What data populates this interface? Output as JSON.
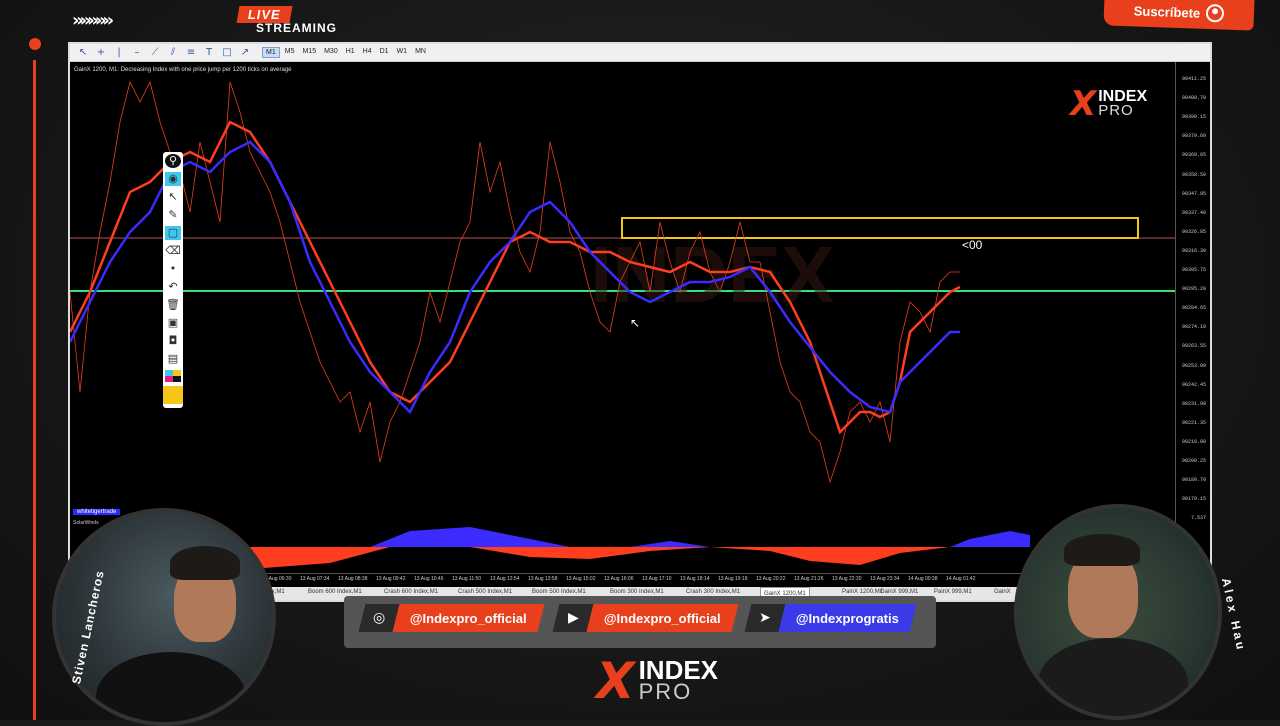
{
  "header": {
    "live_label": "LIVE",
    "streaming_label": "STREAMING",
    "subscribe_label": "Suscríbete",
    "chevrons": "»»»»»"
  },
  "toolbar": {
    "tools": [
      "cursor-icon",
      "crosshair-icon",
      "vline-icon",
      "hline-icon",
      "trendline-icon",
      "channel-icon",
      "fibo-icon",
      "text-icon",
      "shapes-icon",
      "arrows-icon"
    ],
    "timeframes": [
      "M1",
      "M5",
      "M15",
      "M30",
      "H1",
      "H4",
      "D1",
      "W1",
      "MN"
    ],
    "active_timeframe": "M1"
  },
  "chart": {
    "title": "GainX 1200, M1: Decreasing Index with one price jump per 1200 ticks on average",
    "annotation": "<00",
    "price_labels": [
      "90411.25",
      "90400.70",
      "90390.15",
      "90379.60",
      "90369.05",
      "90358.50",
      "90347.95",
      "90337.40",
      "90326.85",
      "90316.30",
      "90305.75",
      "90295.20",
      "90284.65",
      "90274.10",
      "90263.55",
      "90253.00",
      "90242.45",
      "90231.90",
      "90221.35",
      "90210.80",
      "90200.25",
      "90189.70",
      "90179.15",
      "7.537"
    ],
    "time_labels": [
      "13 Aug 06:30",
      "13 Aug 07:34",
      "13 Aug 08:38",
      "13 Aug 09:42",
      "13 Aug 10:46",
      "13 Aug 11:50",
      "13 Aug 12:54",
      "13 Aug 13:58",
      "13 Aug 15:02",
      "13 Aug 16:06",
      "13 Aug 17:10",
      "13 Aug 18:14",
      "13 Aug 19:18",
      "13 Aug 20:22",
      "13 Aug 21:26",
      "13 Aug 22:30",
      "13 Aug 23:34",
      "14 Aug 00:38",
      "14 Aug 01:42"
    ],
    "watermark_tag": "whitetigertrade",
    "oscillator_label": "SolarWinds",
    "tabs": [
      "Index,M1",
      "Boom 600 Index,M1",
      "Crash 600 Index,M1",
      "Crash 500 Index,M1",
      "Boom 500 Index,M1",
      "Boom 300 Index,M1",
      "Crash 300 Index,M1",
      "GainX 1200,M1",
      "PainX 1200,M1",
      "GainX 999,M1",
      "PainX 999,M1",
      "GainX"
    ],
    "active_tab": "GainX 1200,M1"
  },
  "chart_logo": {
    "main": "INDEX",
    "sub": "PRO"
  },
  "social": [
    {
      "icon": "instagram-icon",
      "glyph": "◎",
      "handle": "@Indexpro_official",
      "color": "#e8401c"
    },
    {
      "icon": "youtube-icon",
      "glyph": "▶",
      "handle": "@Indexpro_official",
      "color": "#e8401c"
    },
    {
      "icon": "telegram-icon",
      "glyph": "➤",
      "handle": "@Indexprogratis",
      "color": "#3a3ae8"
    }
  ],
  "footer_logo": {
    "main": "INDEX",
    "sub": "PRO"
  },
  "presenters": {
    "left": "Stiven Lancheros",
    "right": "Alex Hau"
  },
  "colors": {
    "accent": "#e8401c",
    "blue_line": "#3b2bff",
    "green_line": "#39e07a",
    "zone": "#f5c518"
  }
}
